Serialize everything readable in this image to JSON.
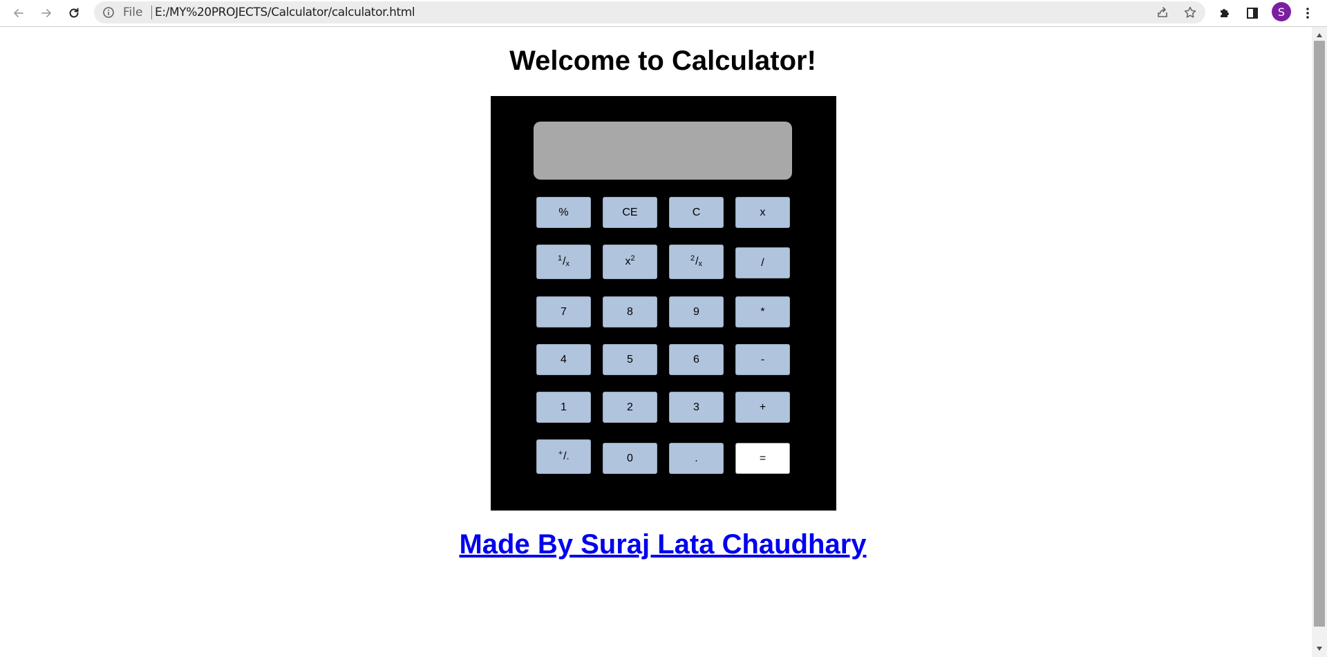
{
  "browser": {
    "address_scheme": "File",
    "address_url": "E:/MY%20PROJECTS/Calculator/calculator.html",
    "avatar_letter": "S"
  },
  "page": {
    "title": "Welcome to Calculator!",
    "credit": "Made By Suraj Lata Chaudhary"
  },
  "calculator": {
    "display_value": "",
    "keys": {
      "percent": "%",
      "clear_entry": "CE",
      "clear": "C",
      "multiply_x": "x",
      "reciprocal_num": "1",
      "reciprocal_den": "x",
      "square_base": "x",
      "square_exp": "2",
      "two_over_num": "2",
      "two_over_den": "x",
      "divide": "/",
      "seven": "7",
      "eight": "8",
      "nine": "9",
      "multiply": "*",
      "four": "4",
      "five": "5",
      "six": "6",
      "minus": "-",
      "one": "1",
      "two": "2",
      "three": "3",
      "plus": "+",
      "sign_plus": "+",
      "sign_minus": "-",
      "zero": "0",
      "decimal": ".",
      "equals": "="
    }
  },
  "colors": {
    "calculator_body": "#000000",
    "display": "#a8a8a8",
    "key": "#b0c4de",
    "equals_key": "#ffffff",
    "link": "#0000ee"
  }
}
